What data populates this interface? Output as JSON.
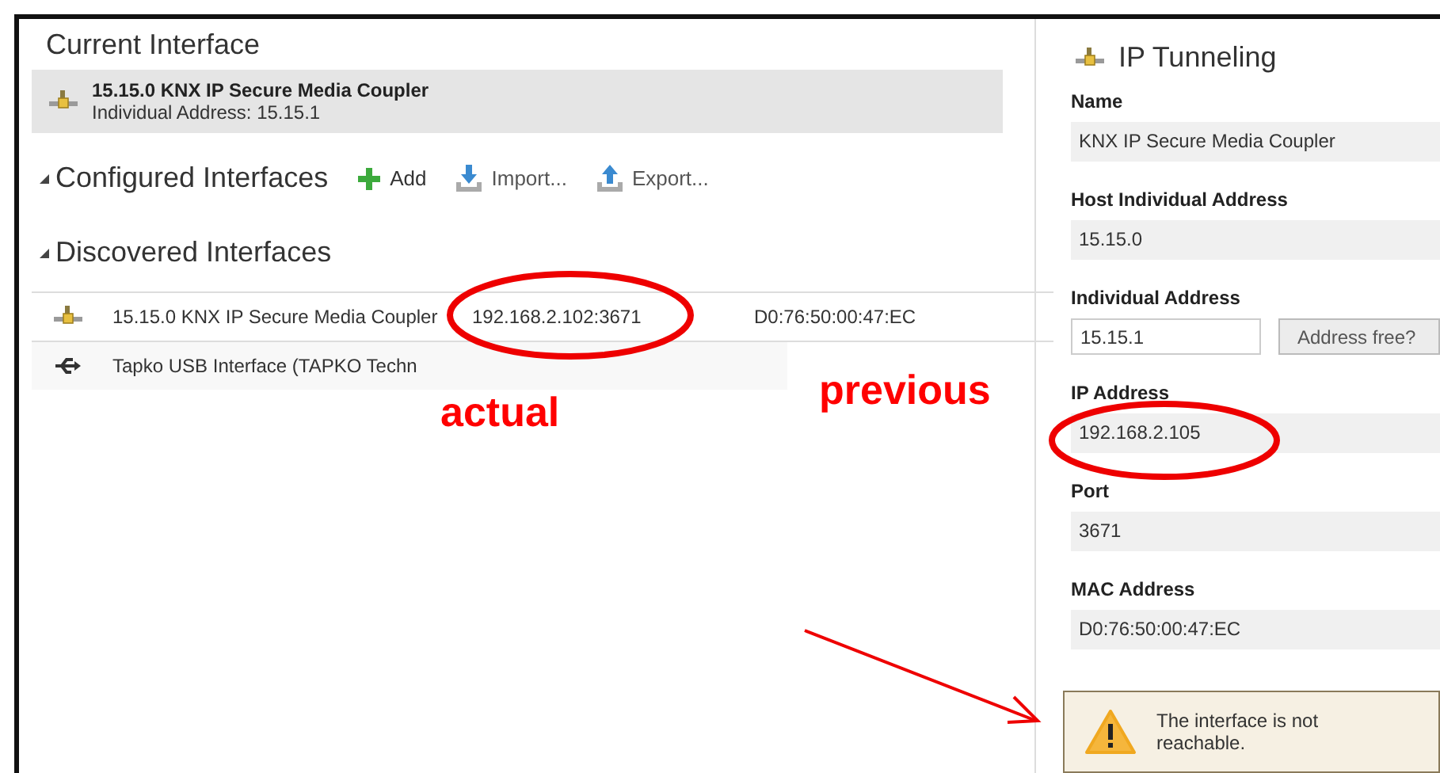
{
  "current_interface": {
    "heading": "Current Interface",
    "name": "15.15.0 KNX IP Secure Media Coupler",
    "address": "Individual Address: 15.15.1"
  },
  "configured": {
    "heading": "Configured Interfaces",
    "expanded": true,
    "actions": [
      {
        "kind": "add",
        "label": "Add"
      },
      {
        "kind": "import",
        "label": "Import..."
      },
      {
        "kind": "export",
        "label": "Export..."
      }
    ]
  },
  "discovered": {
    "heading": "Discovered Interfaces",
    "expanded": true,
    "rows": [
      {
        "kind": "ip",
        "name": "15.15.0 KNX IP Secure Media Coupler",
        "address": "192.168.2.102:3671",
        "mac": "D0:76:50:00:47:EC"
      },
      {
        "kind": "usb",
        "name": "Tapko USB Interface (TAPKO Techn"
      }
    ]
  },
  "details": {
    "title": "IP Tunneling",
    "fields": [
      {
        "kind": "readonly",
        "label": "Name",
        "value": "KNX IP Secure Media Coupler"
      },
      {
        "kind": "readonly",
        "label": "Host Individual Address",
        "value": "15.15.0"
      },
      {
        "kind": "input",
        "label": "Individual Address",
        "value": "15.15.1",
        "button": "Address free?"
      },
      {
        "kind": "readonly",
        "label": "IP Address",
        "value": "192.168.2.105"
      },
      {
        "kind": "readonly",
        "label": "Port",
        "value": "3671"
      },
      {
        "kind": "readonly",
        "label": "MAC Address",
        "value": "D0:76:50:00:47:EC"
      }
    ],
    "warning": "The interface is not reachable."
  },
  "annotations": [
    "actual",
    "previous"
  ]
}
